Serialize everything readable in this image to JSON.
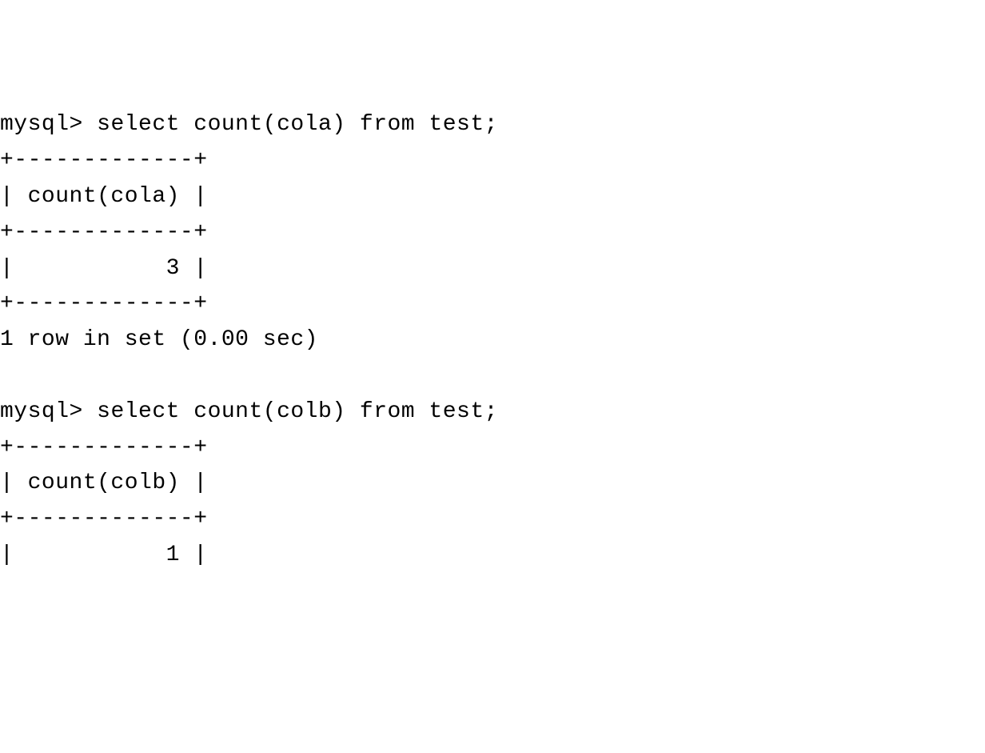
{
  "terminal": {
    "prompt": "mysql>",
    "query1": {
      "command": "select count(cola) from test;",
      "border_top": "+-------------+",
      "header": "| count(cola) |",
      "border_mid": "+-------------+",
      "value_row": "|           3 |",
      "border_bot": "+-------------+",
      "result_msg": "1 row in set (0.00 sec)"
    },
    "query2": {
      "command": "select count(colb) from test;",
      "border_top": "+-------------+",
      "header": "| count(colb) |",
      "border_mid": "+-------------+",
      "value_row": "|           1 |"
    }
  }
}
